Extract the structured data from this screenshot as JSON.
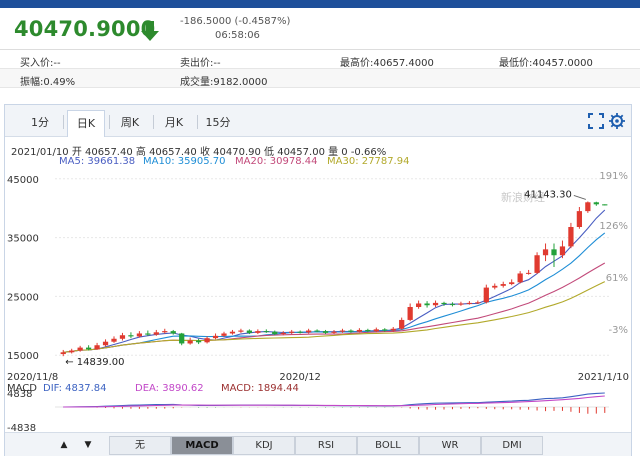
{
  "header": {
    "price": "40470.9000",
    "change": "-186.5000 (-0.4587%)",
    "time": "06:58:06",
    "down_color": "#2d8a2d"
  },
  "info": {
    "bid_label": "买入价:--",
    "ask_label": "卖出价:--",
    "high_label": "最高价:40657.4000",
    "low_label": "最低价:40457.0000",
    "amplitude_label": "振幅:0.49%",
    "volume_label": "成交量:9182.0000"
  },
  "tabs": [
    "1分",
    "日K",
    "周K",
    "月K",
    "15分"
  ],
  "active_tab": "日K",
  "kline_header": {
    "ohlc": "2021/01/10 开 40657.40 高 40657.40 收 40470.90 低 40457.00 量 0 -0.66%",
    "ma5": "MA5: 39661.38",
    "ma10": "MA10: 35905.70",
    "ma20": "MA20: 30978.44",
    "ma30": "MA30: 27787.94"
  },
  "macd_header": {
    "label": "MACD",
    "dif": "DIF: 4837.84",
    "dea": "DEA: 3890.62",
    "macd": "MACD: 1894.44"
  },
  "bottom_tabs": [
    "无",
    "MACD",
    "KDJ",
    "RSI",
    "BOLL",
    "WR",
    "DMI"
  ],
  "active_bottom_tab": "MACD",
  "watermark": "新浪财经",
  "colors": {
    "up": "#e03a30",
    "down": "#23a13a",
    "ma5": "#4a5ec2",
    "ma10": "#1f8ed6",
    "ma20": "#c24a7a",
    "ma30": "#b2a92b",
    "dif": "#3d63c2",
    "dea": "#c248c8",
    "macd": "#9b3030"
  },
  "chart_data": {
    "type": "candlestick",
    "y_ticks": [
      "45000",
      "35000",
      "25000",
      "15000"
    ],
    "right_ticks": [
      "191%",
      "126%",
      "61%",
      "-3%"
    ],
    "x_ticks": [
      "2020/11/8",
      "2020/12",
      "2021/1/10"
    ],
    "ylim": [
      13000,
      47000
    ],
    "annotations": {
      "max": "41143.30",
      "min": "14839.00"
    },
    "candles": [
      {
        "o": 15200,
        "c": 15500,
        "h": 15900,
        "l": 14839
      },
      {
        "o": 15500,
        "c": 15800,
        "h": 16100,
        "l": 15300
      },
      {
        "o": 15800,
        "c": 16300,
        "h": 16600,
        "l": 15600
      },
      {
        "o": 16300,
        "c": 16000,
        "h": 16700,
        "l": 15800
      },
      {
        "o": 16000,
        "c": 16700,
        "h": 17100,
        "l": 15900
      },
      {
        "o": 16700,
        "c": 17300,
        "h": 17700,
        "l": 16500
      },
      {
        "o": 17300,
        "c": 17800,
        "h": 18200,
        "l": 17100
      },
      {
        "o": 17800,
        "c": 18400,
        "h": 18800,
        "l": 17500
      },
      {
        "o": 18400,
        "c": 18200,
        "h": 18900,
        "l": 17900
      },
      {
        "o": 18200,
        "c": 18700,
        "h": 19100,
        "l": 18000
      },
      {
        "o": 18700,
        "c": 18500,
        "h": 19200,
        "l": 18300
      },
      {
        "o": 18500,
        "c": 18900,
        "h": 19300,
        "l": 18300
      },
      {
        "o": 18900,
        "c": 19100,
        "h": 19500,
        "l": 18700
      },
      {
        "o": 19100,
        "c": 18700,
        "h": 19300,
        "l": 18500
      },
      {
        "o": 18700,
        "c": 17000,
        "h": 18800,
        "l": 16700
      },
      {
        "o": 17000,
        "c": 17500,
        "h": 18000,
        "l": 16800
      },
      {
        "o": 17500,
        "c": 17200,
        "h": 17800,
        "l": 16900
      },
      {
        "o": 17200,
        "c": 17900,
        "h": 18200,
        "l": 17000
      },
      {
        "o": 17900,
        "c": 18300,
        "h": 18700,
        "l": 17700
      },
      {
        "o": 18300,
        "c": 18700,
        "h": 19000,
        "l": 18100
      },
      {
        "o": 18700,
        "c": 19000,
        "h": 19300,
        "l": 18500
      },
      {
        "o": 19000,
        "c": 19200,
        "h": 19500,
        "l": 18800
      },
      {
        "o": 19200,
        "c": 18800,
        "h": 19400,
        "l": 18600
      },
      {
        "o": 18800,
        "c": 19100,
        "h": 19400,
        "l": 18600
      },
      {
        "o": 19100,
        "c": 19000,
        "h": 19400,
        "l": 18800
      },
      {
        "o": 19000,
        "c": 18600,
        "h": 19200,
        "l": 18400
      },
      {
        "o": 18600,
        "c": 18800,
        "h": 19100,
        "l": 18400
      },
      {
        "o": 18800,
        "c": 19000,
        "h": 19300,
        "l": 18600
      },
      {
        "o": 19000,
        "c": 18900,
        "h": 19200,
        "l": 18700
      },
      {
        "o": 18900,
        "c": 19200,
        "h": 19500,
        "l": 18700
      },
      {
        "o": 19200,
        "c": 19100,
        "h": 19400,
        "l": 18900
      },
      {
        "o": 19100,
        "c": 18800,
        "h": 19300,
        "l": 18600
      },
      {
        "o": 18800,
        "c": 19000,
        "h": 19300,
        "l": 18600
      },
      {
        "o": 19000,
        "c": 19200,
        "h": 19500,
        "l": 18800
      },
      {
        "o": 19200,
        "c": 19000,
        "h": 19400,
        "l": 18800
      },
      {
        "o": 19000,
        "c": 19300,
        "h": 19600,
        "l": 18900
      },
      {
        "o": 19300,
        "c": 19100,
        "h": 19500,
        "l": 18900
      },
      {
        "o": 19100,
        "c": 19400,
        "h": 19700,
        "l": 18900
      },
      {
        "o": 19400,
        "c": 19200,
        "h": 19600,
        "l": 19000
      },
      {
        "o": 19200,
        "c": 19500,
        "h": 19800,
        "l": 19000
      },
      {
        "o": 19500,
        "c": 21000,
        "h": 21400,
        "l": 19300
      },
      {
        "o": 21000,
        "c": 23200,
        "h": 23800,
        "l": 20800
      },
      {
        "o": 23200,
        "c": 23800,
        "h": 24300,
        "l": 22900
      },
      {
        "o": 23800,
        "c": 23500,
        "h": 24200,
        "l": 23100
      },
      {
        "o": 23500,
        "c": 23900,
        "h": 24300,
        "l": 23200
      },
      {
        "o": 23900,
        "c": 23700,
        "h": 24100,
        "l": 23400
      },
      {
        "o": 23700,
        "c": 23600,
        "h": 24000,
        "l": 23300
      },
      {
        "o": 23600,
        "c": 23800,
        "h": 24100,
        "l": 23400
      },
      {
        "o": 23800,
        "c": 23900,
        "h": 24200,
        "l": 23600
      },
      {
        "o": 23900,
        "c": 24000,
        "h": 24300,
        "l": 23700
      },
      {
        "o": 24000,
        "c": 26500,
        "h": 27000,
        "l": 23800
      },
      {
        "o": 26500,
        "c": 26800,
        "h": 27200,
        "l": 26200
      },
      {
        "o": 26800,
        "c": 27100,
        "h": 27500,
        "l": 26500
      },
      {
        "o": 27100,
        "c": 27400,
        "h": 27900,
        "l": 26900
      },
      {
        "o": 27400,
        "c": 28900,
        "h": 29300,
        "l": 27200
      },
      {
        "o": 28900,
        "c": 29000,
        "h": 29500,
        "l": 28700
      },
      {
        "o": 29000,
        "c": 32000,
        "h": 32500,
        "l": 28800
      },
      {
        "o": 32000,
        "c": 33000,
        "h": 34000,
        "l": 31000
      },
      {
        "o": 33000,
        "c": 32000,
        "h": 34000,
        "l": 30000
      },
      {
        "o": 32000,
        "c": 33500,
        "h": 34500,
        "l": 31500
      },
      {
        "o": 33500,
        "c": 36800,
        "h": 37500,
        "l": 33200
      },
      {
        "o": 36800,
        "c": 39500,
        "h": 40200,
        "l": 36500
      },
      {
        "o": 39500,
        "c": 41000,
        "h": 41143,
        "l": 39200
      },
      {
        "o": 41000,
        "c": 40657,
        "h": 41100,
        "l": 40400
      },
      {
        "o": 40657,
        "c": 40471,
        "h": 40657,
        "l": 40457
      }
    ]
  }
}
